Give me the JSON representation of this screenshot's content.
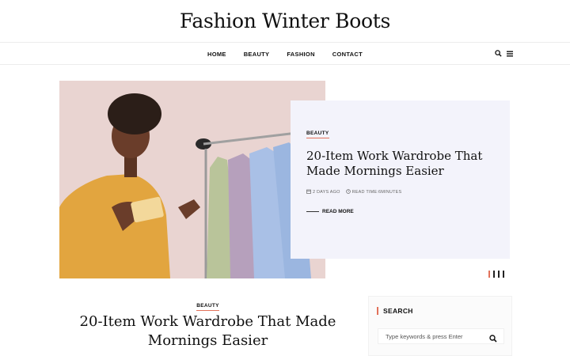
{
  "site": {
    "title": "Fashion Winter Boots"
  },
  "nav": {
    "items": [
      {
        "label": "HOME"
      },
      {
        "label": "BEAUTY"
      },
      {
        "label": "FASHION"
      },
      {
        "label": "CONTACT"
      }
    ],
    "tools": [
      "search-icon",
      "menu-icon"
    ]
  },
  "hero": {
    "category": "BEAUTY",
    "title": "20-Item Work Wardrobe That Made Mornings Easier",
    "date": "2 DAYS AGO",
    "read_time": "READ TIME:6MINUTES",
    "read_more": "READ MORE"
  },
  "slider": {
    "slides": 4,
    "active_index": 0
  },
  "post": {
    "category": "BEAUTY",
    "title": "20-Item Work Wardrobe That Made Mornings Easier"
  },
  "sidebar": {
    "search": {
      "title": "SEARCH",
      "placeholder": "Type keywords & press Enter"
    }
  },
  "colors": {
    "accent": "#e2725b",
    "card_bg": "#f3f3fb",
    "text": "#111111"
  }
}
